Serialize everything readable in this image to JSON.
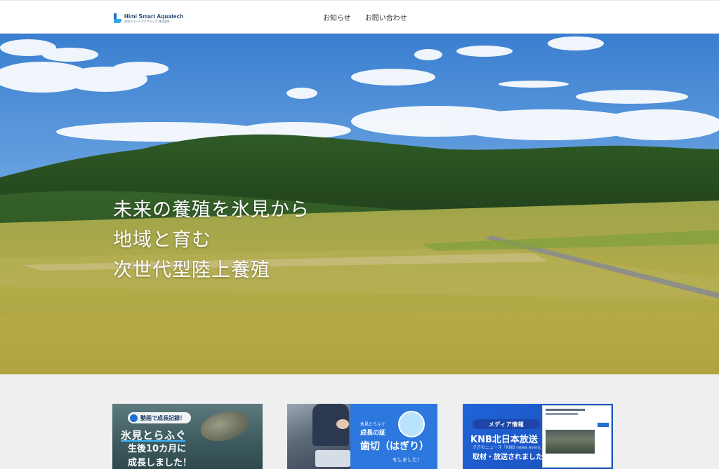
{
  "header": {
    "logo_en": "Himi Smart Aquatech",
    "logo_ja": "氷見スマートアクアテック 株式会社",
    "nav": [
      {
        "label": "お知らせ"
      },
      {
        "label": "お問い合わせ"
      }
    ]
  },
  "hero": {
    "lines": [
      "未来の養殖を氷見から",
      "地域と育む",
      "次世代型陸上養殖"
    ]
  },
  "cards": [
    {
      "badge": "動画で成長記録！",
      "line1": "氷見とらふぐ",
      "line2": "生後10カ月に",
      "line3": "成長しました！"
    },
    {
      "small": "氷見とらふぐ",
      "mid": "成長の証",
      "big": "歯切（はぎり）",
      "end": "をしました！"
    },
    {
      "badge": "メディア情報",
      "title": "KNB北日本放送",
      "sub": "夕方のニュース「KNB news every.」で",
      "main": "取材・放送されました"
    }
  ],
  "colors": {
    "accent": "#1e6fcf",
    "header_bg": "#ffffff",
    "section_bg": "#efefef"
  }
}
